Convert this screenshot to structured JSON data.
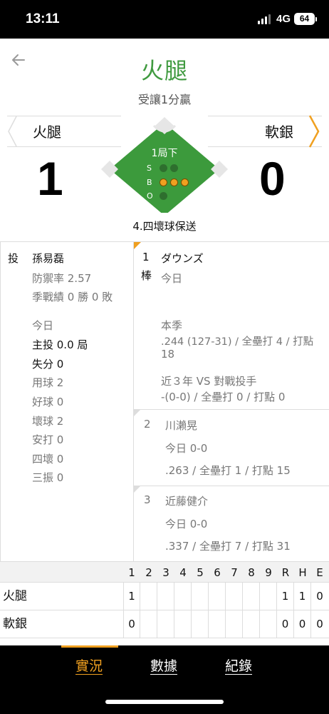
{
  "status_bar": {
    "time": "13:11",
    "network": "4G",
    "battery": "64"
  },
  "header": {
    "back_icon": "back-arrow-icon",
    "title": "火腿",
    "subtitle": "受讓1分贏"
  },
  "scoreboard": {
    "home_team": "火腿",
    "away_team": "軟銀",
    "home_score": "1",
    "away_score": "0",
    "inning": "1局下",
    "count_labels": [
      "S",
      "B",
      "O"
    ],
    "strikes": 0,
    "balls": 3,
    "outs": 0,
    "play_description": "4.四壞球保送",
    "colors": {
      "field": "#3c9a3c",
      "title": "#3f9a3f",
      "accent": "#f0a020"
    }
  },
  "pitcher": {
    "pos_label": "投",
    "name": "孫易磊",
    "era": "防禦率 2.57",
    "season_record": "季戰績 0 勝 0 敗",
    "today_label": "今日",
    "innings": "主投 0.0 局",
    "runs": "失分 0",
    "pitches": "用球 2",
    "strikes": "好球 0",
    "balls": "壞球 2",
    "hits": "安打 0",
    "walks": "四壞 0",
    "strikeouts": "三振 0"
  },
  "batters": [
    {
      "order": "1",
      "pos_label": "棒",
      "name": "ダウンズ",
      "today_label": "今日",
      "today": "",
      "season_label": "本季",
      "season_line1": ".244 (127-31) / 全壘打 4 / 打點",
      "season_line2": "18",
      "vs_label": "近３年 VS 對戰投手",
      "vs_line": "-(0-0) / 全壘打 0 / 打點 0"
    },
    {
      "order": "2",
      "name": "川瀨晃",
      "today": "今日 0-0",
      "season": ".263 / 全壘打 1 / 打點 15"
    },
    {
      "order": "3",
      "name": "近藤健介",
      "today": "今日 0-0",
      "season": ".337 / 全壘打 7 / 打點 31"
    }
  ],
  "linescore": {
    "headers": [
      "1",
      "2",
      "3",
      "4",
      "5",
      "6",
      "7",
      "8",
      "9",
      "R",
      "H",
      "E"
    ],
    "rows": [
      {
        "team": "火腿",
        "innings": [
          "1",
          "",
          "",
          "",
          "",
          "",
          "",
          "",
          ""
        ],
        "r": "1",
        "h": "1",
        "e": "0"
      },
      {
        "team": "軟銀",
        "innings": [
          "0",
          "",
          "",
          "",
          "",
          "",
          "",
          "",
          ""
        ],
        "r": "0",
        "h": "0",
        "e": "0"
      }
    ]
  },
  "bottom_nav": {
    "tabs": [
      "實況",
      "數據",
      "紀錄"
    ],
    "active": "實況"
  }
}
